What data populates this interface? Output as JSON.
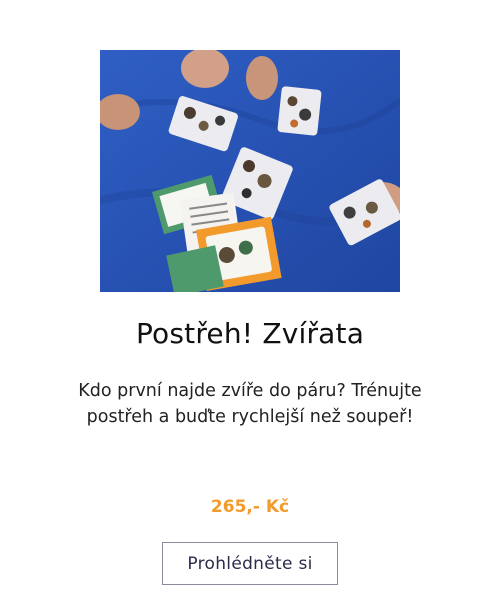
{
  "product": {
    "title": "Postřeh! Zvířata",
    "description": "Kdo první najde zvíře do páru? Trénujte postřeh a buďte rychlejší než soupeř!",
    "price": "265,- Kč",
    "view_button_label": "Prohlédněte si"
  },
  "colors": {
    "price": "#f39a2c",
    "photo_background": "#2a55b8"
  }
}
